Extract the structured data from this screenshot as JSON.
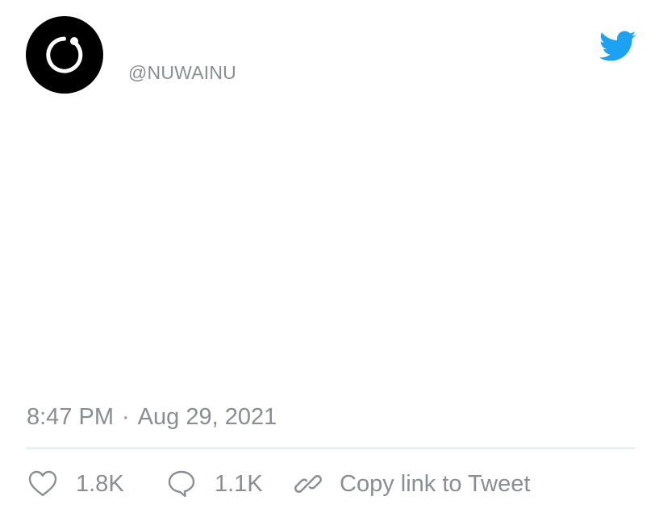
{
  "tweet": {
    "author_handle": "@NUWAINU",
    "avatar_icon": "ring-with-dot-logo-icon",
    "brand_icon": "twitter-bird-icon",
    "time": "8:47 PM",
    "separator": "·",
    "date": "Aug 29, 2021"
  },
  "actions": {
    "like_icon": "heart-icon",
    "like_count": "1.8K",
    "reply_icon": "speech-bubble-icon",
    "reply_count": "1.1K",
    "copy_icon": "link-icon",
    "copy_label": "Copy link to Tweet"
  },
  "colors": {
    "twitter_blue": "#1DA1F2",
    "muted_text": "#8A8D91",
    "divider": "#CFD9DE",
    "avatar_bg": "#000000"
  }
}
